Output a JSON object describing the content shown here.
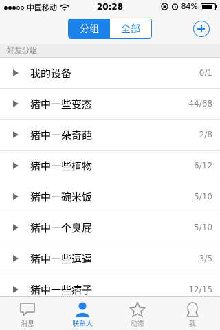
{
  "status_bar": {
    "carrier": "中国移动",
    "time": "20:28",
    "battery": "84%",
    "battery_level": 0.84
  },
  "nav": {
    "segments": [
      {
        "label": "分组",
        "active": true
      },
      {
        "label": "全部",
        "active": false
      }
    ],
    "add_icon": "plus-circle-icon"
  },
  "section": {
    "title": "好友分组"
  },
  "groups": [
    {
      "name": "我的设备",
      "count": "0/1"
    },
    {
      "name": "猪中一些变态",
      "count": "44/68"
    },
    {
      "name": "猪中一朵奇葩",
      "count": "2/8"
    },
    {
      "name": "猪中一些植物",
      "count": "6/12"
    },
    {
      "name": "猪中一碗米饭",
      "count": "5/10"
    },
    {
      "name": "猪中一个臭屁",
      "count": "5/10"
    },
    {
      "name": "猪中一些逗逼",
      "count": "3/5"
    },
    {
      "name": "猪中一些痞子",
      "count": "12/15"
    }
  ],
  "tabs": [
    {
      "label": "消息",
      "icon": "chat-bubble-icon",
      "active": false
    },
    {
      "label": "联系人",
      "icon": "person-icon",
      "active": true
    },
    {
      "label": "动态",
      "icon": "star-icon",
      "active": false
    },
    {
      "label": "我",
      "icon": "profile-icon",
      "active": false
    }
  ],
  "colors": {
    "accent": "#1a82ea",
    "inactive": "#8e8e8e"
  }
}
